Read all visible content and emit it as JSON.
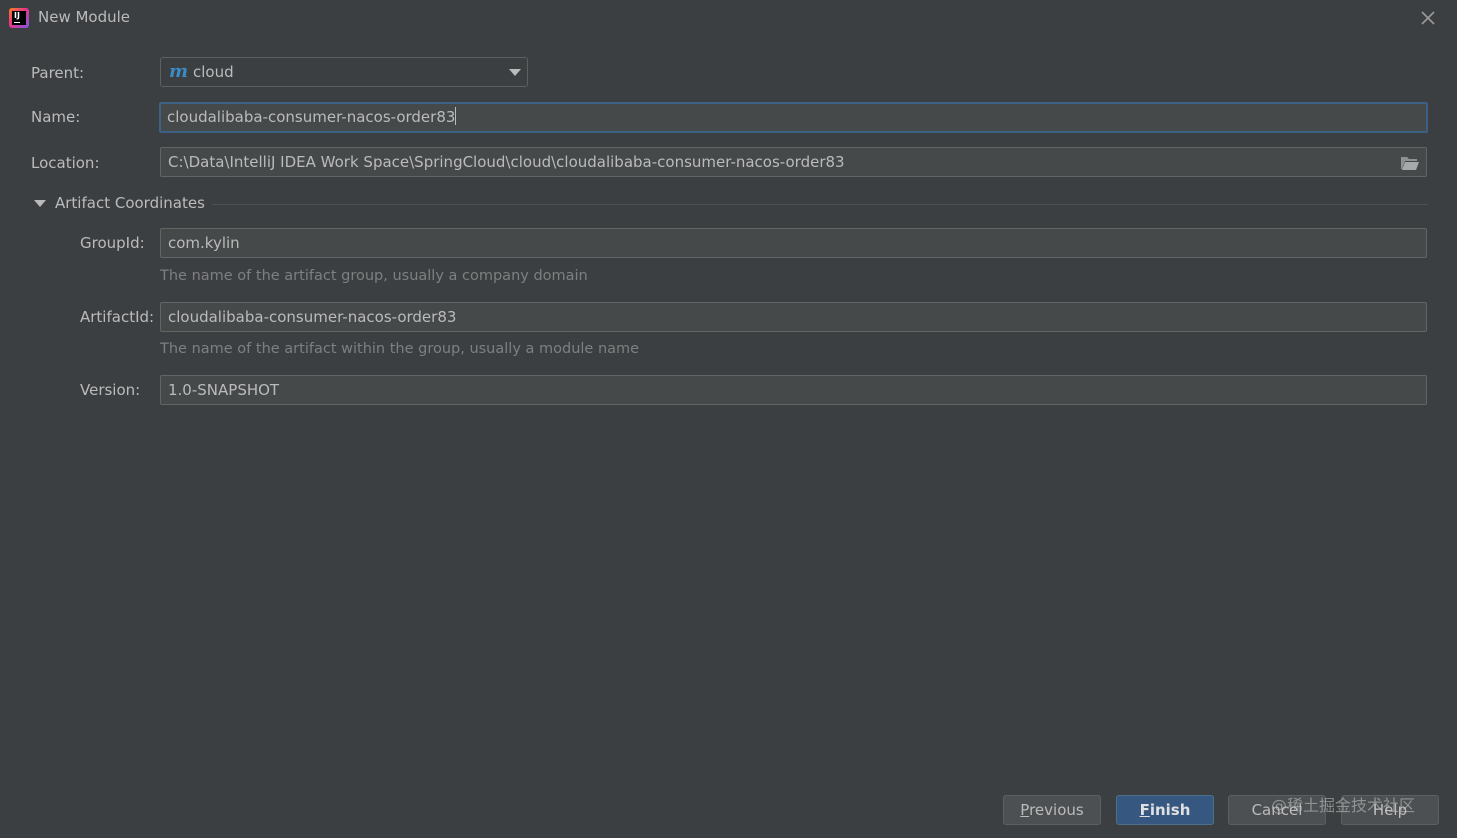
{
  "window": {
    "title": "New Module"
  },
  "form": {
    "parent_label": "Parent:",
    "parent_value": "cloud",
    "name_label": "Name:",
    "name_value": "cloudalibaba-consumer-nacos-order83",
    "location_label": "Location:",
    "location_value": "C:\\Data\\IntelliJ IDEA Work Space\\SpringCloud\\cloud\\cloudalibaba-consumer-nacos-order83"
  },
  "artifact": {
    "section_title": "Artifact Coordinates",
    "group_label": "GroupId:",
    "group_value": "com.kylin",
    "group_hint": "The name of the artifact group, usually a company domain",
    "artifact_label": "ArtifactId:",
    "artifact_value": "cloudalibaba-consumer-nacos-order83",
    "artifact_hint": "The name of the artifact within the group, usually a module name",
    "version_label": "Version:",
    "version_value": "1.0-SNAPSHOT"
  },
  "buttons": {
    "previous_mnemonic": "P",
    "previous_rest": "revious",
    "finish_mnemonic": "F",
    "finish_rest": "inish",
    "cancel_label": "Cancel",
    "help_label": "Help"
  },
  "watermark": "@稀土掘金技术社区",
  "icons": {
    "app": "intellij-idea-icon",
    "close": "close-icon",
    "parent": "maven-module-icon",
    "folder": "folder-icon"
  },
  "colors": {
    "background": "#3c3f41",
    "field_bg": "#45494a",
    "focus_border": "#3d6185",
    "primary_button": "#365880",
    "maven_icon": "#3a8cc4"
  }
}
